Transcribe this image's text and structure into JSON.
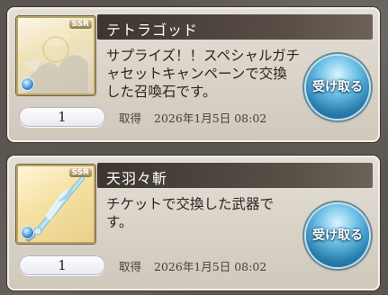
{
  "items": [
    {
      "name": "テトラゴッド",
      "rarity": "SSR",
      "description": "サプライズ！！スペシャルガチャセットキャンペーンで交換した召喚石です。",
      "quantity": "1",
      "acquired_label": "取得",
      "acquired_date": "2026年1月5日 08:02",
      "receive_label": "受け取る",
      "thumb_icon": "summon-stone-icon"
    },
    {
      "name": "天羽々斬",
      "rarity": "SSR",
      "description": "チケットで交換した武器です。",
      "quantity": "1",
      "acquired_label": "取得",
      "acquired_date": "2026年1月5日 08:02",
      "receive_label": "受け取る",
      "thumb_icon": "sword-icon"
    }
  ],
  "colors": {
    "name_bar": "#3c3530",
    "card_bg": "#e4dfd6",
    "receive_button": "#2a7fae"
  }
}
